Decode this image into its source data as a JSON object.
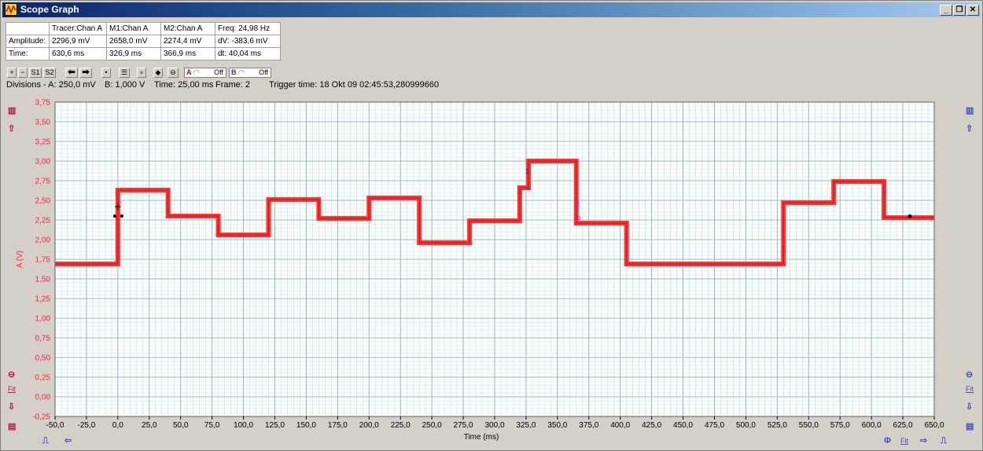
{
  "window": {
    "title": "Scope Graph",
    "buttons": {
      "minimize": "_",
      "restore": "❐",
      "close": "✕"
    }
  },
  "measurements": {
    "headers": [
      "",
      "Tracer:Chan A",
      "M1:Chan A",
      "M2:Chan A",
      "Freq: 24,98 Hz"
    ],
    "rows": [
      [
        "Amplitude:",
        "2296,9 mV",
        "2658,0 mV",
        "2274,4 mV",
        "dV: -383,6 mV"
      ],
      [
        "Time:",
        "630,6 ms",
        "326,9 ms",
        "366,9 ms",
        "dt:  40,04 ms"
      ]
    ]
  },
  "toolbar": {
    "zoom_in": "+",
    "zoom_out": "−",
    "s1": "S1",
    "s2": "S2",
    "channel_a_label": "A",
    "channel_a_state": "Off",
    "channel_b_label": "B",
    "channel_b_state": "Off"
  },
  "info": {
    "divisions": "Divisions -  A: 250,0 mV",
    "div_b": "B: 1,000 V",
    "time": "Time: 25,00 ms",
    "frame": "Frame: 2",
    "trigger": "Trigger time: 18 Okt 09 02:45:53,280999660"
  },
  "side": {
    "fit_left": "Fit",
    "fit_right": "Fit",
    "fit_bottom": "Fit"
  },
  "colors": {
    "trace": "#ff2a2a",
    "grid_major": "#8aa8b0",
    "grid_minor": "#b8e4e0",
    "axis_text": "#ff2040"
  },
  "chart_data": {
    "type": "line",
    "xlabel": "Time (ms)",
    "ylabel": "A (V)",
    "xlim": [
      -50,
      650
    ],
    "ylim": [
      -0.25,
      3.75
    ],
    "x_ticks": [
      "-50,0",
      "-25,0",
      "0,0",
      "25,0",
      "50,0",
      "75,0",
      "100,0",
      "125,0",
      "150,0",
      "175,0",
      "200,0",
      "225,0",
      "250,0",
      "275,0",
      "300,0",
      "325,0",
      "350,0",
      "375,0",
      "400,0",
      "425,0",
      "450,0",
      "475,0",
      "500,0",
      "525,0",
      "550,0",
      "575,0",
      "600,0",
      "625,0",
      "650,0"
    ],
    "y_ticks": [
      "-0,25",
      "0,00",
      "0,25",
      "0,50",
      "0,75",
      "1,00",
      "1,25",
      "1,50",
      "1,75",
      "2,00",
      "2,25",
      "2,50",
      "2,75",
      "3,00",
      "3,25",
      "3,50",
      "3,75"
    ],
    "grid": true,
    "series": [
      {
        "x": [
          -50,
          0,
          0,
          40,
          40,
          80,
          80,
          120,
          120,
          160,
          160,
          200,
          200,
          240,
          240,
          280,
          280,
          320,
          320,
          327,
          327,
          365,
          365,
          405,
          405,
          530,
          530,
          570,
          570,
          610,
          610,
          650
        ],
        "y": [
          1.69,
          1.69,
          2.63,
          2.63,
          2.3,
          2.3,
          2.06,
          2.06,
          2.51,
          2.51,
          2.27,
          2.27,
          2.53,
          2.53,
          1.96,
          1.96,
          2.24,
          2.24,
          2.66,
          2.66,
          3.0,
          3.0,
          2.21,
          2.21,
          1.69,
          1.69,
          2.47,
          2.47,
          2.74,
          2.74,
          2.28,
          2.28
        ]
      }
    ],
    "markers": {
      "m1_label": "1",
      "m2_label": "2"
    }
  }
}
